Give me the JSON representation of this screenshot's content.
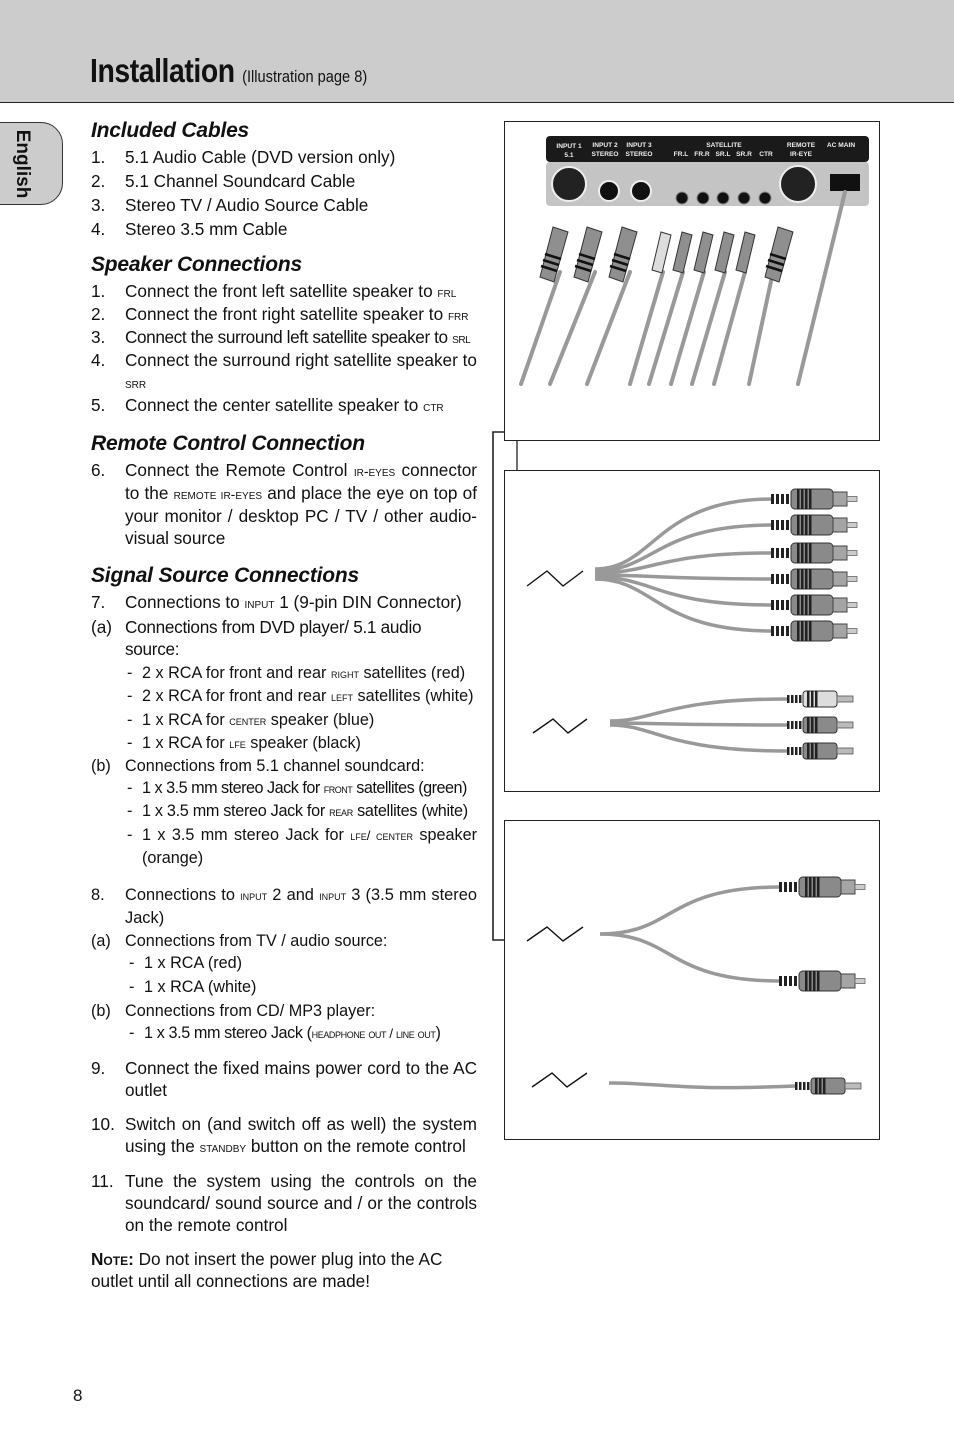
{
  "header": {
    "title": "Installation",
    "subtitle": "(Illustration page 8)"
  },
  "language_tab": "English",
  "sections": {
    "included_cables": {
      "heading": "Included Cables",
      "items": [
        {
          "num": "1.",
          "text": "5.1 Audio Cable (DVD version only)"
        },
        {
          "num": "2.",
          "text": "5.1 Channel Soundcard Cable"
        },
        {
          "num": "3.",
          "text": "Stereo TV / Audio Source Cable"
        },
        {
          "num": "4.",
          "text": "Stereo 3.5 mm Cable"
        }
      ]
    },
    "speaker_connections": {
      "heading": "Speaker Connections",
      "items": [
        {
          "num": "1.",
          "text": "Connect the front left satellite speaker to",
          "code": "FRL"
        },
        {
          "num": "2.",
          "text": "Connect the front right satellite speaker to",
          "code": "FRR"
        },
        {
          "num": "3.",
          "text": "Connect the surround left satellite speaker to",
          "code": "SRL"
        },
        {
          "num": "4.",
          "text": "Connect the surround right satellite speaker to",
          "code": "SRR"
        },
        {
          "num": "5.",
          "text": "Connect the center satellite speaker to",
          "code": "CTR"
        }
      ]
    },
    "remote_control": {
      "heading": "Remote Control Connection",
      "item": {
        "num": "6.",
        "t1": "Connect the Remote Control",
        "c1": "IR-EYES",
        "t2": "connector to the",
        "c2": "REMOTE IR-EYES",
        "t3": "and place the eye on top of your monitor / desktop PC / TV / other audio-visual source"
      }
    },
    "signal_source": {
      "heading": "Signal Source Connections",
      "item7": {
        "num": "7.",
        "t1": "Connections to",
        "c1": "INPUT",
        "t2": "1 (9-pin DIN Connector)"
      },
      "item7a": {
        "num": "(a)",
        "text": "Connections from DVD player/ 5.1 audio source:"
      },
      "item7a_subs": [
        {
          "t1": "2 x RCA for front and rear",
          "c": "RIGHT",
          "t2": "satellites (red)"
        },
        {
          "t1": "2 x RCA for front and rear",
          "c": "LEFT",
          "t2": "satellites (white)"
        },
        {
          "t1": "1 x RCA for",
          "c": "CENTER",
          "t2": "speaker (blue)"
        },
        {
          "t1": "1 x RCA for",
          "c": "LFE",
          "t2": "speaker (black)"
        }
      ],
      "item7b": {
        "num": "(b)",
        "text": "Connections from 5.1 channel soundcard:"
      },
      "item7b_subs": [
        {
          "t1": "1 x 3.5 mm stereo Jack for",
          "c": "FRONT",
          "t2": "satellites (green)"
        },
        {
          "t1": "1 x 3.5 mm stereo Jack for",
          "c": "REAR",
          "t2": "satellites (white)"
        },
        {
          "t1": "1 x 3.5 mm stereo Jack for",
          "c": "LFE/ CENTER",
          "t2": "speaker (orange)"
        }
      ],
      "item8": {
        "num": "8.",
        "t1": "Connections to",
        "c1": "INPUT",
        "t2": "2 and",
        "c2": "INPUT",
        "t3": "3 (3.5 mm stereo Jack)"
      },
      "item8a": {
        "num": "(a)",
        "text": "Connections from TV / audio source:"
      },
      "item8a_subs": [
        {
          "text": "1 x RCA (red)"
        },
        {
          "text": "1 x RCA (white)"
        }
      ],
      "item8b": {
        "num": "(b)",
        "text": "Connections from CD/ MP3 player:"
      },
      "item8b_sub": {
        "t1": "1 x 3.5 mm stereo Jack (",
        "c": "HEADPHONE OUT / LINE OUT",
        "t2": ")"
      },
      "item9": {
        "num": "9.",
        "text": "Connect the fixed mains power cord to the AC outlet"
      },
      "item10": {
        "num": "10.",
        "t1": "Switch on (and switch off as well) the system using the",
        "c": "STANDBY",
        "t2": "button on the remote control"
      },
      "item11": {
        "num": "11.",
        "text": "Tune the system using the controls on the soundcard/ sound source and / or the controls on the remote control"
      },
      "note": {
        "label": "Note:",
        "text": "Do not insert the power plug into the AC outlet until all connections are made!"
      }
    }
  },
  "illustration": {
    "panel_labels": [
      {
        "l1": "INPUT 1",
        "l2": "5.1"
      },
      {
        "l1": "INPUT 2",
        "l2": "STEREO"
      },
      {
        "l1": "INPUT 3",
        "l2": "STEREO"
      },
      {
        "l1": "SATELLITE",
        "l2": ""
      },
      {
        "l1": "REMOTE",
        "l2": "IR-EYE"
      },
      {
        "l1": "AC MAIN",
        "l2": ""
      }
    ],
    "satellite_labels": [
      "FR.L",
      "FR.R",
      "SR.L",
      "SR.R",
      "CTR"
    ]
  },
  "page_number": "8"
}
